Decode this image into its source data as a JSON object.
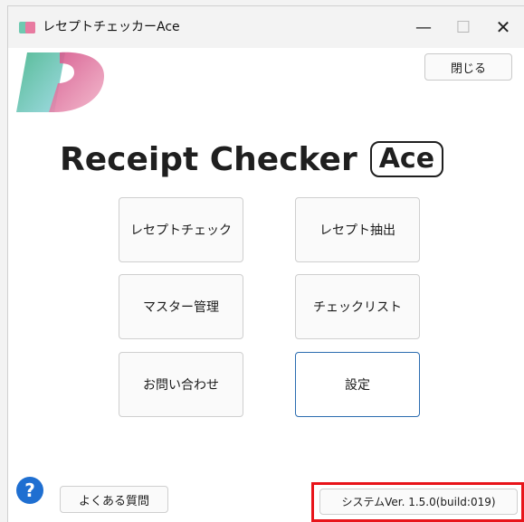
{
  "window": {
    "title": "レセプトチェッカーAce",
    "controls": {
      "minimize": "—",
      "maximize": "☐",
      "close": "✕"
    }
  },
  "header": {
    "close_button": "閉じる"
  },
  "app_title": {
    "main": "Receipt Checker",
    "badge": "Ace"
  },
  "menu": {
    "items": [
      {
        "label": "レセプトチェック"
      },
      {
        "label": "レセプト抽出"
      },
      {
        "label": "マスター管理"
      },
      {
        "label": "チェックリスト"
      },
      {
        "label": "お問い合わせ"
      },
      {
        "label": "設定"
      }
    ]
  },
  "footer": {
    "faq_button": "よくある質問",
    "version": "システムVer. 1.5.0(build:019)",
    "help_icon": "?"
  },
  "colors": {
    "accent_focus": "#2b6cb0",
    "highlight_red": "#e8141a",
    "logo_teal": "#6ec9b0",
    "logo_pink": "#e87aa0",
    "help_blue": "#1f6fd1"
  },
  "icons": [
    "app-logo-icon",
    "minimize-icon",
    "maximize-icon",
    "close-icon",
    "help-icon"
  ]
}
